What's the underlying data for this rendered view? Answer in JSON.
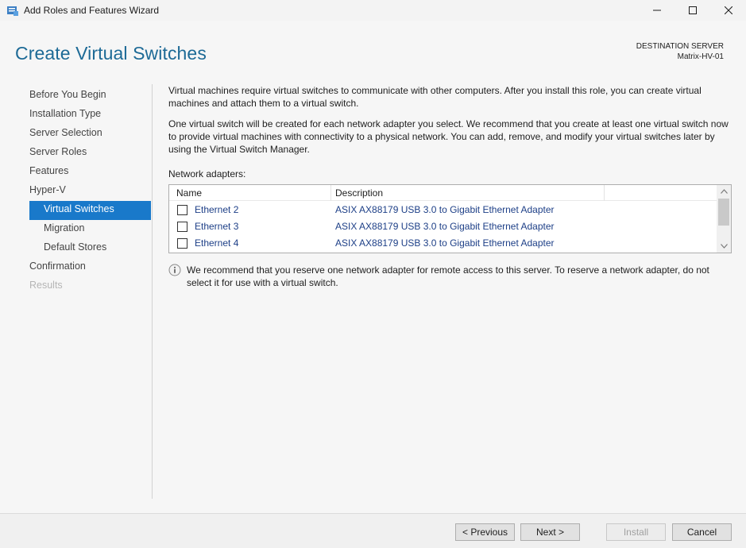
{
  "window": {
    "title": "Add Roles and Features Wizard"
  },
  "header": {
    "page_title": "Create Virtual Switches",
    "destination_label": "DESTINATION SERVER",
    "destination_server": "Matrix-HV-01"
  },
  "nav": {
    "items": [
      {
        "label": "Before You Begin",
        "state": "normal"
      },
      {
        "label": "Installation Type",
        "state": "normal"
      },
      {
        "label": "Server Selection",
        "state": "normal"
      },
      {
        "label": "Server Roles",
        "state": "normal"
      },
      {
        "label": "Features",
        "state": "normal"
      },
      {
        "label": "Hyper-V",
        "state": "normal"
      },
      {
        "label": "Virtual Switches",
        "state": "active"
      },
      {
        "label": "Migration",
        "state": "normal"
      },
      {
        "label": "Default Stores",
        "state": "normal"
      },
      {
        "label": "Confirmation",
        "state": "normal"
      },
      {
        "label": "Results",
        "state": "disabled"
      }
    ]
  },
  "main": {
    "para1": "Virtual machines require virtual switches to communicate with other computers. After you install this role, you can create virtual machines and attach them to a virtual switch.",
    "para2": "One virtual switch will be created for each network adapter you select. We recommend that you create at least one virtual switch now to provide virtual machines with connectivity to a physical network. You can add, remove, and modify your virtual switches later by using the Virtual Switch Manager.",
    "adapters_label": "Network adapters:",
    "columns": {
      "name": "Name",
      "description": "Description"
    },
    "adapters": [
      {
        "name": "Ethernet 2",
        "description": "ASIX AX88179 USB 3.0 to Gigabit Ethernet Adapter",
        "checked": false
      },
      {
        "name": "Ethernet 3",
        "description": "ASIX AX88179 USB 3.0 to Gigabit Ethernet Adapter",
        "checked": false
      },
      {
        "name": "Ethernet 4",
        "description": "ASIX AX88179 USB 3.0 to Gigabit Ethernet Adapter",
        "checked": false
      }
    ],
    "info_text": "We recommend that you reserve one network adapter for remote access to this server. To reserve a network adapter, do not select it for use with a virtual switch."
  },
  "footer": {
    "previous": "< Previous",
    "next": "Next >",
    "install": "Install",
    "cancel": "Cancel"
  },
  "colors": {
    "accent": "#1979ca",
    "title": "#1d6a96",
    "link": "#1d3f87"
  }
}
